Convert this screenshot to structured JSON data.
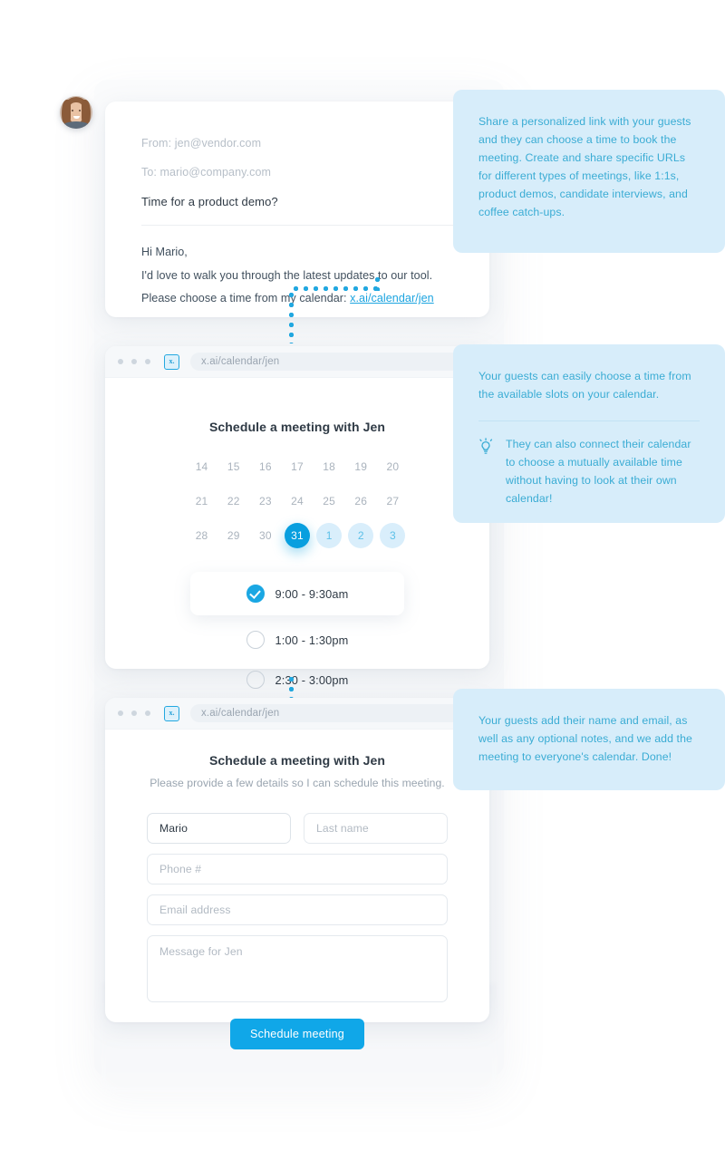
{
  "avatar": {
    "alt": "jen-avatar"
  },
  "email": {
    "from_label": "From: jen@vendor.com",
    "to_label": "To: mario@company.com",
    "subject": "Time for a product demo?",
    "greeting": "Hi Mario,",
    "line1": "I'd love to walk you through the latest updates to our tool.",
    "line2_prefix": "Please choose a time from my calendar: ",
    "link": "x.ai/calendar/jen"
  },
  "browser": {
    "logo_text": "x.",
    "url": "x.ai/calendar/jen"
  },
  "calendar": {
    "title": "Schedule a meeting with Jen",
    "days": [
      {
        "n": "14",
        "state": "normal"
      },
      {
        "n": "15",
        "state": "normal"
      },
      {
        "n": "16",
        "state": "normal"
      },
      {
        "n": "17",
        "state": "normal"
      },
      {
        "n": "18",
        "state": "normal"
      },
      {
        "n": "19",
        "state": "normal"
      },
      {
        "n": "20",
        "state": "normal"
      },
      {
        "n": "21",
        "state": "normal"
      },
      {
        "n": "22",
        "state": "normal"
      },
      {
        "n": "23",
        "state": "normal"
      },
      {
        "n": "24",
        "state": "normal"
      },
      {
        "n": "25",
        "state": "normal"
      },
      {
        "n": "26",
        "state": "normal"
      },
      {
        "n": "27",
        "state": "normal"
      },
      {
        "n": "28",
        "state": "normal"
      },
      {
        "n": "29",
        "state": "normal"
      },
      {
        "n": "30",
        "state": "normal"
      },
      {
        "n": "31",
        "state": "selected"
      },
      {
        "n": "1",
        "state": "next"
      },
      {
        "n": "2",
        "state": "next"
      },
      {
        "n": "3",
        "state": "next"
      }
    ],
    "slots": [
      {
        "label": "9:00 - 9:30am",
        "selected": true
      },
      {
        "label": "1:00 - 1:30pm",
        "selected": false
      },
      {
        "label": "2:30 - 3:00pm",
        "selected": false
      }
    ]
  },
  "form": {
    "title": "Schedule a meeting with Jen",
    "subtitle": "Please provide a few details so I can schedule this meeting.",
    "first_name_value": "Mario",
    "last_name_placeholder": "Last name",
    "phone_placeholder": "Phone #",
    "email_placeholder": "Email address",
    "message_placeholder": "Message for Jen",
    "submit_label": "Schedule meeting"
  },
  "callouts": {
    "one": "Share a personalized link with your guests and they can choose a time to book the meeting. Create and share specific URLs for different types of meetings, like 1:1s, product demos, candidate interviews, and coffee catch-ups.",
    "two_main": "Your guests can easily choose a time from the available slots on your calendar.",
    "two_tip": "They can also connect their calendar to choose a mutually available time without having to look at their own calendar!",
    "three": "Your guests add their name and email, as well as any optional notes, and we add the meeting to everyone's calendar. Done!"
  },
  "colors": {
    "accent": "#10a7e8",
    "callout_bg": "#d7edfa",
    "callout_text": "#3aacd4",
    "selected_day": "#089fdf",
    "next_day_bg": "#d9eefb"
  }
}
